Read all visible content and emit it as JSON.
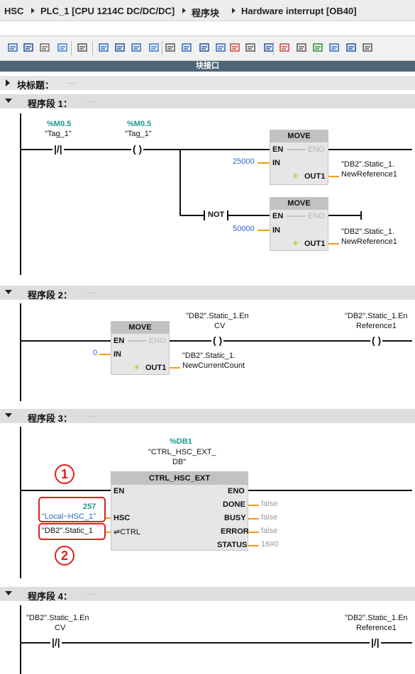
{
  "breadcrumb": [
    "HSC",
    "PLC_1 [CPU 1214C DC/DC/DC]",
    "程序块",
    "Hardware interrupt [OB40]"
  ],
  "toolbar_icons": [
    "insert-network-icon",
    "delete-network-icon",
    "insert-row-icon",
    "append-row-icon",
    "monitor-icon",
    "absolute-icon",
    "network-view-icon",
    "comment-icon",
    "favorites-icon",
    "box-icon",
    "open-branch-icon",
    "close-branch-icon",
    "connection-icon",
    "assignment-icon",
    "jump-icon",
    "go-online-icon",
    "go-offline-icon",
    "compare-icon",
    "download-icon",
    "upload-icon",
    "first-icon",
    "next-icon"
  ],
  "interface_bar": "块接口",
  "block_title": {
    "label": "块标题：",
    "comment": "....."
  },
  "networks": [
    {
      "label": "程序段 1：",
      "comment": "....."
    },
    {
      "label": "程序段 2：",
      "comment": "....."
    },
    {
      "label": "程序段 3：",
      "comment": "....."
    },
    {
      "label": "程序段 4：",
      "comment": "....."
    }
  ],
  "net1": {
    "c1_addr": "%M0.5",
    "c1_tag": "\"Tag_1\"",
    "c2_addr": "%M0.5",
    "c2_tag": "\"Tag_1\"",
    "move1": {
      "title": "MOVE",
      "en": "EN",
      "eno": "ENO",
      "in": "IN",
      "out": "OUT1",
      "in_val": "25000",
      "out_tag1": "\"DB2\".Static_1.",
      "out_tag2": "NewReference1"
    },
    "not": "NOT",
    "move2": {
      "title": "MOVE",
      "en": "EN",
      "eno": "ENO",
      "in": "IN",
      "out": "OUT1",
      "in_val": "50000",
      "out_tag1": "\"DB2\".Static_1.",
      "out_tag2": "NewReference1"
    }
  },
  "net2": {
    "move": {
      "title": "MOVE",
      "en": "EN",
      "eno": "ENO",
      "in": "IN",
      "out": "OUT1",
      "in_val": "0",
      "out_tag1": "\"DB2\".Static_1.",
      "out_tag2": "NewCurrentCount"
    },
    "coil1_tag1": "\"DB2\".Static_1.En",
    "coil1_tag2": "CV",
    "coil2_tag1": "\"DB2\".Static_1.En",
    "coil2_tag2": "Reference1"
  },
  "net3": {
    "db_addr": "%DB1",
    "db_name1": "\"CTRL_HSC_EXT_",
    "db_name2": "DB\"",
    "title": "CTRL_HSC_EXT",
    "en": "EN",
    "eno": "ENO",
    "hsc": "HSC",
    "ctrl": "⇌CTRL",
    "done": "DONE",
    "busy": "BUSY",
    "error": "ERROR",
    "status": "STATUS",
    "done_val": "false",
    "busy_val": "false",
    "error_val": "false",
    "status_val": "16#0",
    "hsc_num": "257",
    "hsc_tag": "\"Local~HSC_1\"",
    "ctrl_tag": "\"DB2\".Static_1",
    "mark1": "1",
    "mark2": "2"
  },
  "net4": {
    "c1_tag1": "\"DB2\".Static_1.En",
    "c1_tag2": "CV",
    "c2_tag1": "\"DB2\".Static_1.En",
    "c2_tag2": "Reference1"
  }
}
